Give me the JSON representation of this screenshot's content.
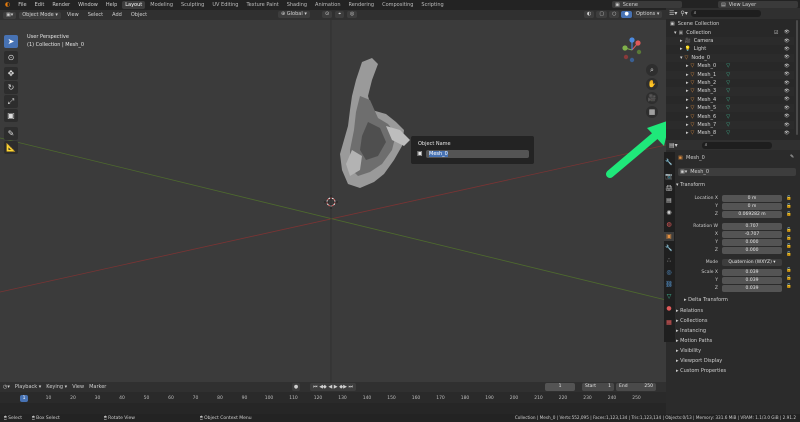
{
  "topbar": {
    "menus": [
      "File",
      "Edit",
      "Render",
      "Window",
      "Help"
    ],
    "workspaces": [
      "Layout",
      "Modeling",
      "Sculpting",
      "UV Editing",
      "Texture Paint",
      "Shading",
      "Animation",
      "Rendering",
      "Compositing",
      "Scripting"
    ],
    "active_workspace": "Layout",
    "scene": "Scene",
    "view_layer": "View Layer"
  },
  "viewport_header": {
    "mode": "Object Mode",
    "view": "View",
    "select": "Select",
    "add": "Add",
    "object": "Object",
    "transform_orientation": "Global",
    "options": "Options"
  },
  "viewport": {
    "title": "User Perspective",
    "subtitle": "(1) Collection | Mesh_0"
  },
  "popup": {
    "title": "Object Name",
    "value": "Mesh_0"
  },
  "outliner": {
    "root": "Scene Collection",
    "items": [
      {
        "label": "Collection",
        "color": "#9a9a9a"
      },
      {
        "label": "Camera",
        "color": "#e4903f"
      },
      {
        "label": "Light",
        "color": "#e4903f"
      },
      {
        "label": "Node_0",
        "color": "#e4903f"
      },
      {
        "label": "Mesh_0",
        "color": "#e4903f"
      },
      {
        "label": "Mesh_1",
        "color": "#e4903f"
      },
      {
        "label": "Mesh_2",
        "color": "#e4903f"
      },
      {
        "label": "Mesh_3",
        "color": "#e4903f"
      },
      {
        "label": "Mesh_4",
        "color": "#e4903f"
      },
      {
        "label": "Mesh_5",
        "color": "#e4903f"
      },
      {
        "label": "Mesh_6",
        "color": "#e4903f"
      },
      {
        "label": "Mesh_7",
        "color": "#e4903f"
      },
      {
        "label": "Mesh_8",
        "color": "#e4903f"
      }
    ]
  },
  "properties": {
    "object_name": "Mesh_0",
    "data_name": "Mesh_0",
    "transform_header": "Transform",
    "location": {
      "x_label": "Location X",
      "y_label": "Y",
      "z_label": "Z",
      "x": "0 m",
      "y": "0 m",
      "z": "0.069282 m"
    },
    "rotation": {
      "w_label": "Rotation W",
      "x_label": "X",
      "y_label": "Y",
      "z_label": "Z",
      "w": "0.707",
      "x": "-0.707",
      "y": "0.000",
      "z": "0.000"
    },
    "mode_label": "Mode",
    "mode": "Quaternion (WXYZ)",
    "scale": {
      "x_label": "Scale X",
      "y_label": "Y",
      "z_label": "Z",
      "x": "0.039",
      "y": "0.039",
      "z": "0.039"
    },
    "delta_transform": "Delta Transform",
    "sections": [
      "Relations",
      "Collections",
      "Instancing",
      "Motion Paths",
      "Visibility",
      "Viewport Display",
      "Custom Properties"
    ]
  },
  "timeline": {
    "playback": "Playback",
    "keying": "Keying",
    "view": "View",
    "marker": "Marker",
    "current_frame": "1",
    "start_label": "Start",
    "start": "1",
    "end_label": "End",
    "end": "250",
    "ticks": [
      "0",
      "10",
      "20",
      "30",
      "40",
      "50",
      "60",
      "70",
      "80",
      "90",
      "100",
      "110",
      "120",
      "130",
      "140",
      "150",
      "160",
      "170",
      "180",
      "190",
      "200",
      "210",
      "220",
      "230",
      "240",
      "250"
    ],
    "frame_marker": "1"
  },
  "statusbar": {
    "select": "Select",
    "box_select": "Box Select",
    "rotate_view": "Rotate View",
    "context_menu": "Object Context Menu",
    "stats": "Collection | Mesh_0 | Verts:552,095 | Faces:1,123,134 | Tris:1,123,134 | Objects:0/13 | Memory: 331.6 MiB | VRAM: 1.1/3.0 GiB | 2.91.2"
  },
  "colors": {
    "accent": "#4772b3",
    "arrow": "#1fe87a",
    "orange": "#e4903f",
    "mesh_green": "#3fc29a"
  }
}
